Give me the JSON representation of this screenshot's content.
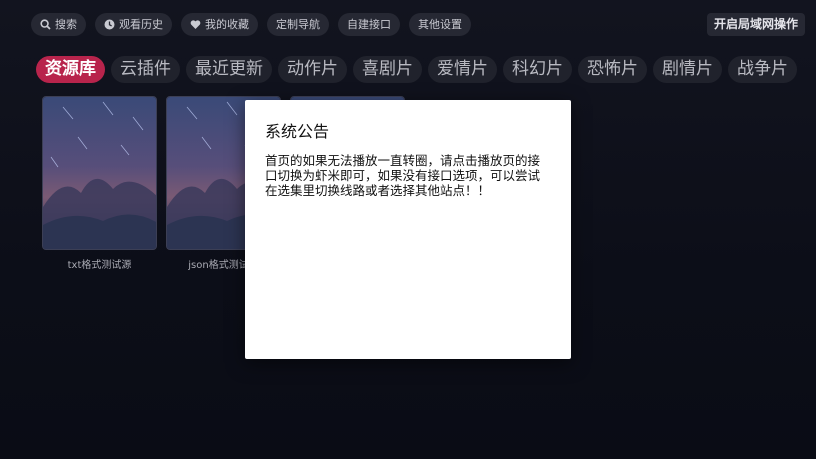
{
  "toolbar": {
    "search_label": "搜索",
    "history_label": "观看历史",
    "favorites_label": "我的收藏",
    "custom_nav_label": "定制导航",
    "custom_api_label": "自建接口",
    "other_settings_label": "其他设置",
    "lan_label": "开启局域网操作"
  },
  "tabs": [
    "资源库",
    "云插件",
    "最近更新",
    "动作片",
    "喜剧片",
    "爱情片",
    "科幻片",
    "恐怖片",
    "剧情片",
    "战争片"
  ],
  "active_tab": "资源库",
  "posters": [
    {
      "caption": "txt格式测试源"
    },
    {
      "caption": "json格式测试源"
    },
    {
      "caption": ""
    }
  ],
  "dialog": {
    "title": "系统公告",
    "body": "首页的如果无法播放一直转圈，请点击播放页的接口切换为虾米即可，如果没有接口选项，可以尝试在选集里切换线路或者选择其他站点！！"
  },
  "colors": {
    "active_tab": "#b8244c",
    "background": "#0d0f1a",
    "pill": "#262833"
  }
}
